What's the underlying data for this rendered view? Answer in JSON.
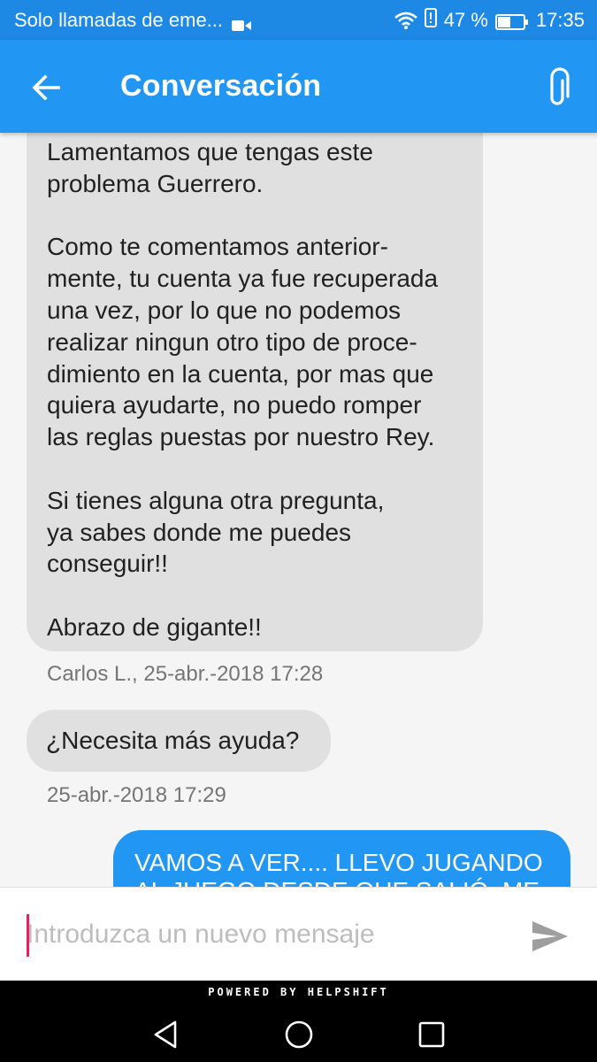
{
  "status_bar": {
    "carrier_text": "Solo llamadas de eme...",
    "battery_percent": "47 %",
    "time": "17:35"
  },
  "app_bar": {
    "title": "Conversación"
  },
  "messages": [
    {
      "text": "Lamentamos que tengas este\nproblema Guerrero.\n\nComo te comentamos anterior-\nmente, tu cuenta ya fue recuperada\nuna vez, por lo que no podemos\nrealizar ningun otro tipo de proce-\ndimiento en la cuenta, por mas que\nquiera ayudarte, no puedo romper\nlas reglas puestas por nuestro Rey.\n\nSi tienes alguna otra pregunta,\nya sabes donde me puedes\nconseguir!!\n\nAbrazo de gigante!!",
      "meta": "Carlos L., 25-abr.-2018 17:28"
    },
    {
      "text": "¿Necesita más ayuda?",
      "meta": "25-abr.-2018 17:29"
    },
    {
      "text": "VAMOS A VER.... LLEVO JUGANDO\nAL JUEGO DESDE QUE SALIÓ, ME"
    }
  ],
  "composer": {
    "placeholder": "Introduzca un nuevo mensaje",
    "value": ""
  },
  "footer": {
    "powered_by": "POWERED BY HELPSHIFT"
  },
  "colors": {
    "primary": "#2196f3",
    "status_bar": "#1e88e5",
    "incoming_bubble": "#e0e0e0",
    "cursor": "#e91e63"
  }
}
